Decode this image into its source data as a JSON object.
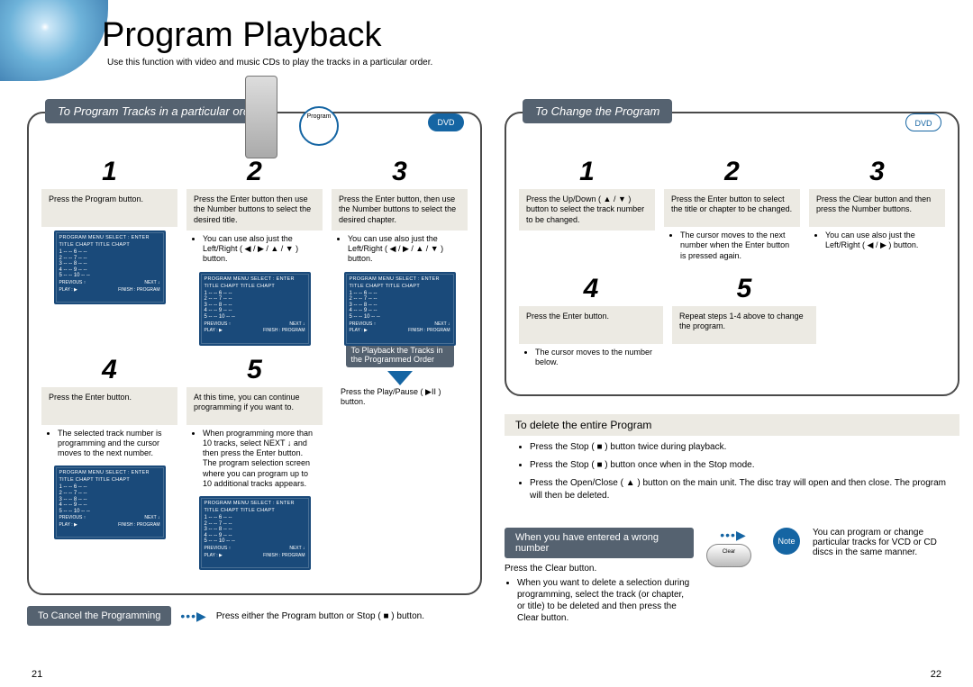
{
  "title": "Program Playback",
  "subtitle": "Use this function with video and music CDs to play the tracks in a particular order.",
  "pageLeftNum": "21",
  "pageRightNum": "22",
  "leftPanel": {
    "header": "To Program Tracks in a particular order",
    "programBadge": "Program",
    "dvd": "DVD",
    "steps1": [
      {
        "num": "1",
        "body": "Press the Program  button."
      },
      {
        "num": "2",
        "body": "Press the Enter  button then use the Number buttons to select the desired title.",
        "note": "You can use  also just the Left/Right  ( ◀ / ▶ / ▲ / ▼ ) button."
      },
      {
        "num": "3",
        "body": "Press the Enter button, then use the Number buttons to select the desired chapter.",
        "note": "You can use also just the Left/Right  ( ◀ / ▶ / ▲ / ▼ ) button."
      }
    ],
    "steps2": [
      {
        "num": "4",
        "body": "Press the Enter  button.",
        "note": "The selected track number is programming and the cursor moves to the next number."
      },
      {
        "num": "5",
        "body": "At this time, you can continue programming if you want to.",
        "note": "When programming more than 10 tracks, select NEXT ↓ and then press the Enter  button. The program selection screen where you can program up to 10 additional tracks appears."
      }
    ],
    "playbackTag": "To Playback the Tracks in the Programmed Order",
    "playInstr": "Press the Play/Pause ( ▶II ) button.",
    "tv": {
      "menu": "PROGRAM MENU   SELECT : ENTER",
      "cols": "TITLE CHAPT        TITLE CHAPT",
      "rows": [
        "1  --  --        6  --  --",
        "2  --  --        7  --  --",
        "3  --  --        8  --  --",
        "4  --  --        9  --  --",
        "5  --  --       10  --  --"
      ],
      "prev": "PREVIOUS ↑",
      "next": "NEXT ↓",
      "play": "PLAY : ▶",
      "finish": "FINISH : PROGRAM"
    },
    "cancel": {
      "header": "To Cancel the Programming",
      "text": "Press either the Program  button or Stop ( ■ ) button."
    }
  },
  "rightPanel": {
    "header": "To Change the Program",
    "dvd": "DVD",
    "steps1": [
      {
        "num": "1",
        "body": "Press the Up/Down  ( ▲ / ▼ ) button to select the track number to be changed."
      },
      {
        "num": "2",
        "body": "Press the Enter  button to select the title or chapter to be changed.",
        "note": "The cursor moves to the next number when the Enter  button is pressed again."
      },
      {
        "num": "3",
        "body": "Press the Clear  button and then press the Number buttons.",
        "note": "You can use also just the Left/Right  ( ◀ / ▶ ) button."
      }
    ],
    "steps2": [
      {
        "num": "4",
        "body": "Press the Enter  button.",
        "note": "The cursor moves to the number below."
      },
      {
        "num": "5",
        "body": "Repeat steps 1-4 above to change the program."
      }
    ],
    "deleteHeader": "To delete the entire Program",
    "deleteItems": [
      "Press the Stop  ( ■ ) button twice during playback.",
      "Press the Stop  ( ■ ) button once when in the Stop mode.",
      "Press the Open/Close  ( ▲ ) button on the main unit. The disc tray will open and then close. The program will then be deleted."
    ],
    "wrongHeader": "When you have entered a wrong number",
    "clearLabel": "Clear",
    "wrongBody": "Press the Clear button.",
    "wrongNote": "When you want to delete a selection during programming, select the track (or chapter, or title) to be deleted and then press the Clear  button.",
    "noteLabel": "Note",
    "noteText": "You can program or change particular tracks for VCD or CD discs in the same manner."
  }
}
